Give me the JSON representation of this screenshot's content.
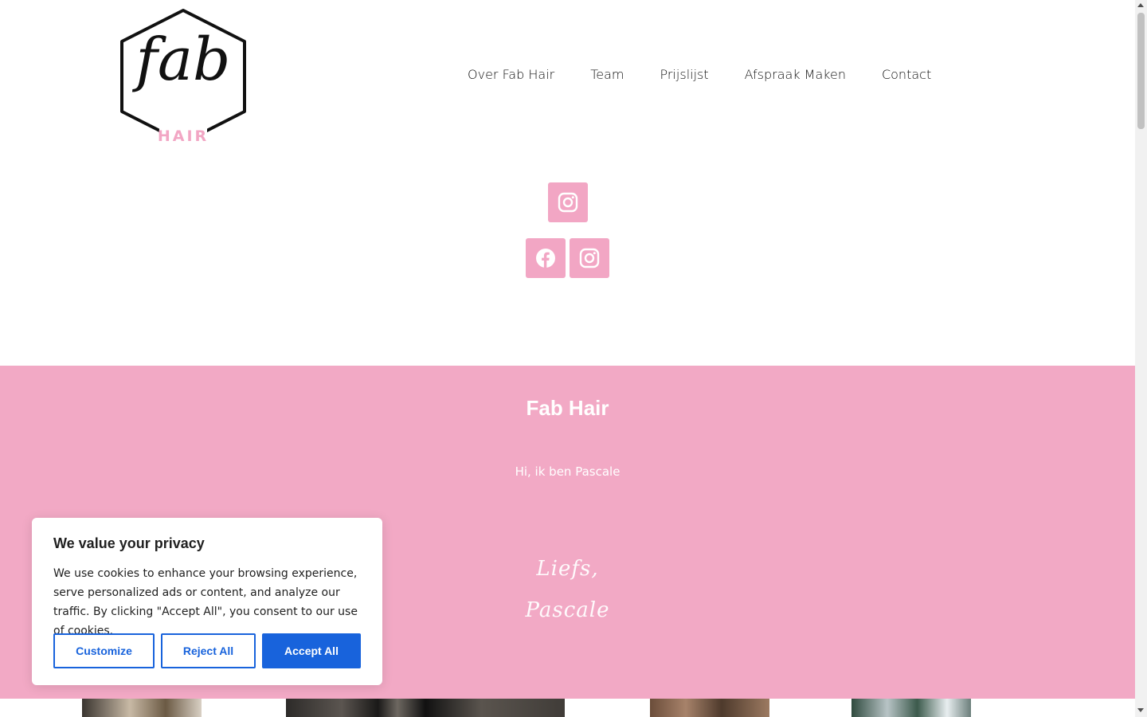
{
  "logo": {
    "fab": "fab",
    "hair": "HAIR"
  },
  "nav": {
    "items": [
      "Over Fab Hair",
      "Team",
      "Prijslijst",
      "Afspraak Maken",
      "Contact"
    ]
  },
  "social": {
    "icons": [
      "instagram-icon",
      "facebook-icon",
      "instagram-icon"
    ],
    "color": "#f2a6c4"
  },
  "about": {
    "title": "Fab Hair",
    "intro": "Hi, ik ben Pascale",
    "sign_line1": "Liefs,",
    "sign_line2": "Pascale",
    "background": "#f2a9c5"
  },
  "cookie": {
    "title": "We value your privacy",
    "text": "We use cookies to enhance your browsing experience, serve personalized ads or content, and analyze our traffic. By clicking \"Accept All\", you consent to our use of cookies.",
    "customize": "Customize",
    "reject": "Reject All",
    "accept": "Accept All",
    "accent": "#1863dc"
  }
}
